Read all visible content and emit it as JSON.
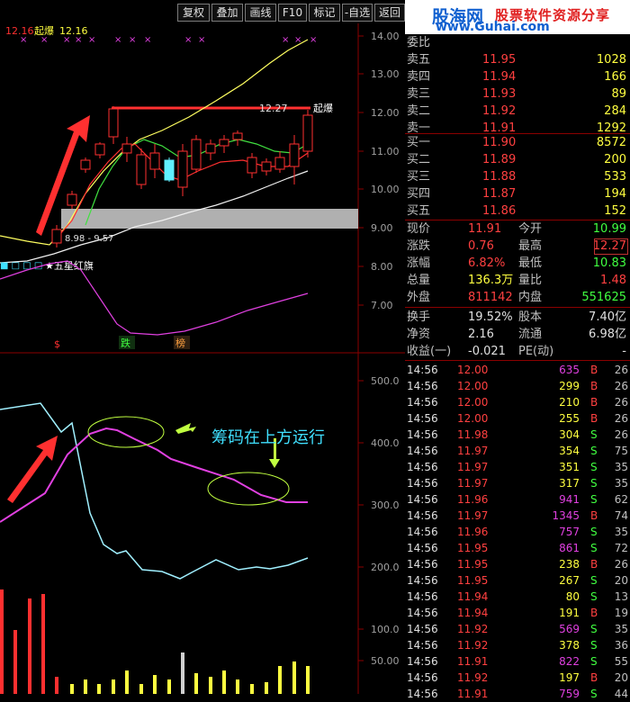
{
  "toolbar": {
    "buttons": [
      "复权",
      "叠加",
      "画线",
      "F10",
      "标记",
      "-自选",
      "返回"
    ]
  },
  "chart_header": {
    "price": "12.16",
    "indicator_label": "起爆",
    "indicator_value": "12.16"
  },
  "annotations": {
    "price_line_label": "12.27",
    "qibao_label": "起爆",
    "range_label": "8.98 - 9.57",
    "wuxing_label": "★五星红旗",
    "mark_s": "$",
    "mark_die": "跌",
    "mark_bang": "榜",
    "chip_note": "筹码在上方运行"
  },
  "main_axis": [
    "14.00",
    "13.00",
    "12.00",
    "11.00",
    "10.00",
    "9.00",
    "8.00",
    "7.00"
  ],
  "lower_axis": [
    "500.0",
    "400.0",
    "300.0",
    "200.0",
    "100.0",
    "50.00"
  ],
  "banner": {
    "brand": "股海网",
    "slogan": "股票软件资源分享",
    "url": "www.Guhai.com"
  },
  "order_book": {
    "header": "委比",
    "asks": [
      {
        "label": "卖五",
        "price": "11.95",
        "vol": "1028"
      },
      {
        "label": "卖四",
        "price": "11.94",
        "vol": "166"
      },
      {
        "label": "卖三",
        "price": "11.93",
        "vol": "89"
      },
      {
        "label": "卖二",
        "price": "11.92",
        "vol": "284"
      },
      {
        "label": "卖一",
        "price": "11.91",
        "vol": "1292"
      }
    ],
    "bids": [
      {
        "label": "买一",
        "price": "11.90",
        "vol": "8572"
      },
      {
        "label": "买二",
        "price": "11.89",
        "vol": "200"
      },
      {
        "label": "买三",
        "price": "11.88",
        "vol": "533"
      },
      {
        "label": "买四",
        "price": "11.87",
        "vol": "194"
      },
      {
        "label": "买五",
        "price": "11.86",
        "vol": "152"
      }
    ]
  },
  "quote": [
    {
      "l1": "现价",
      "v1": "11.91",
      "c1": "#ff4040",
      "l2": "今开",
      "v2": "10.99",
      "c2": "#40ff40"
    },
    {
      "l1": "涨跌",
      "v1": "0.76",
      "c1": "#ff4040",
      "l2": "最高",
      "v2": "12.27",
      "c2": "#ff4040"
    },
    {
      "l1": "涨幅",
      "v1": "6.82%",
      "c1": "#ff4040",
      "l2": "最低",
      "v2": "10.83",
      "c2": "#40ff40"
    },
    {
      "l1": "总量",
      "v1": "136.3万",
      "c1": "#ffff40",
      "l2": "量比",
      "v2": "1.48",
      "c2": "#ff4040"
    },
    {
      "l1": "外盘",
      "v1": "811142",
      "c1": "#ff4040",
      "l2": "内盘",
      "v2": "551625",
      "c2": "#40ff40"
    }
  ],
  "fundamentals": [
    {
      "l1": "换手",
      "v1": "19.52%",
      "l2": "股本",
      "v2": "7.40亿"
    },
    {
      "l1": "净资",
      "v1": "2.16",
      "l2": "流通",
      "v2": "6.98亿"
    },
    {
      "l1": "收益(一)",
      "v1": "-0.021",
      "l2": "PE(动)",
      "v2": "-"
    }
  ],
  "ticks": [
    {
      "time": "14:56",
      "price": "12.00",
      "vol": "635",
      "bs": "B",
      "n": "26"
    },
    {
      "time": "14:56",
      "price": "12.00",
      "vol": "299",
      "bs": "B",
      "n": "26"
    },
    {
      "time": "14:56",
      "price": "12.00",
      "vol": "210",
      "bs": "B",
      "n": "26"
    },
    {
      "time": "14:56",
      "price": "12.00",
      "vol": "255",
      "bs": "B",
      "n": "26"
    },
    {
      "time": "14:56",
      "price": "11.98",
      "vol": "304",
      "bs": "S",
      "n": "26"
    },
    {
      "time": "14:56",
      "price": "11.97",
      "vol": "354",
      "bs": "S",
      "n": "75"
    },
    {
      "time": "14:56",
      "price": "11.97",
      "vol": "351",
      "bs": "S",
      "n": "35"
    },
    {
      "time": "14:56",
      "price": "11.97",
      "vol": "317",
      "bs": "S",
      "n": "35"
    },
    {
      "time": "14:56",
      "price": "11.96",
      "vol": "941",
      "bs": "S",
      "n": "62"
    },
    {
      "time": "14:56",
      "price": "11.97",
      "vol": "1345",
      "bs": "B",
      "n": "74"
    },
    {
      "time": "14:56",
      "price": "11.96",
      "vol": "757",
      "bs": "S",
      "n": "35"
    },
    {
      "time": "14:56",
      "price": "11.95",
      "vol": "861",
      "bs": "S",
      "n": "72"
    },
    {
      "time": "14:56",
      "price": "11.95",
      "vol": "238",
      "bs": "B",
      "n": "26"
    },
    {
      "time": "14:56",
      "price": "11.95",
      "vol": "267",
      "bs": "S",
      "n": "20"
    },
    {
      "time": "14:56",
      "price": "11.94",
      "vol": "80",
      "bs": "S",
      "n": "13"
    },
    {
      "time": "14:56",
      "price": "11.94",
      "vol": "191",
      "bs": "B",
      "n": "19"
    },
    {
      "time": "14:56",
      "price": "11.92",
      "vol": "569",
      "bs": "S",
      "n": "35"
    },
    {
      "time": "14:56",
      "price": "11.92",
      "vol": "378",
      "bs": "S",
      "n": "36"
    },
    {
      "time": "14:56",
      "price": "11.91",
      "vol": "822",
      "bs": "S",
      "n": "55"
    },
    {
      "time": "14:56",
      "price": "11.92",
      "vol": "197",
      "bs": "B",
      "n": "20"
    },
    {
      "time": "14:56",
      "price": "11.91",
      "vol": "759",
      "bs": "S",
      "n": "44"
    }
  ]
}
